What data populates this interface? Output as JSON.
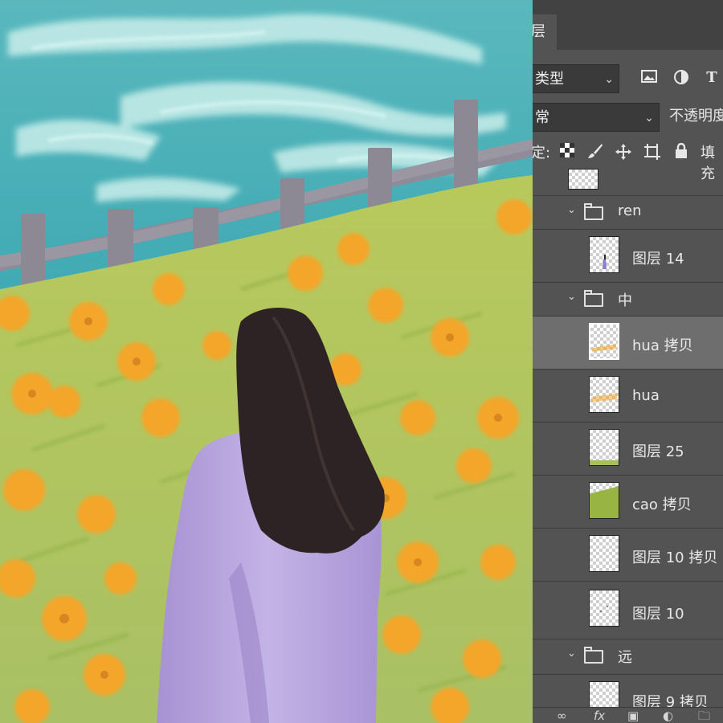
{
  "layers_panel": {
    "tab_label": "层",
    "filter": {
      "kind_label": "类型",
      "icons": [
        "image-filter-icon",
        "adjustment-filter-icon",
        "type-filter-icon"
      ]
    },
    "blend_mode": "常",
    "opacity_label": "不透明度",
    "lock_label": "定:",
    "fill_label": "填充",
    "lock_icons": [
      "lock-transparent-icon",
      "lock-paint-icon",
      "lock-move-icon",
      "lock-artboard-icon",
      "lock-all-icon"
    ],
    "rows": [
      {
        "type": "group",
        "name": "ren"
      },
      {
        "type": "layer",
        "name": "图层 14"
      },
      {
        "type": "group",
        "name": "中"
      },
      {
        "type": "layer",
        "name": "hua 拷贝",
        "selected": true
      },
      {
        "type": "layer",
        "name": "hua"
      },
      {
        "type": "layer",
        "name": "图层 25"
      },
      {
        "type": "layer",
        "name": "cao 拷贝"
      },
      {
        "type": "layer",
        "name": "图层 10 拷贝"
      },
      {
        "type": "layer",
        "name": "图层 10"
      },
      {
        "type": "group",
        "name": "远"
      },
      {
        "type": "layer",
        "name": "图层 9 拷贝"
      }
    ],
    "bottom_icons": [
      "link-icon",
      "fx-icon",
      "mask-icon",
      "adjustment-icon",
      "new-group-icon"
    ],
    "bottom_fx_label": "fx"
  },
  "canvas": {
    "description_colors": {
      "sky": "#4fb3b8",
      "cloud": "#bfe9e6",
      "fence": "#8e8a96",
      "grass": "#b3c65a",
      "flower": "#f0a52c",
      "hair": "#2e2224",
      "coat": "#b9a6dc"
    }
  }
}
